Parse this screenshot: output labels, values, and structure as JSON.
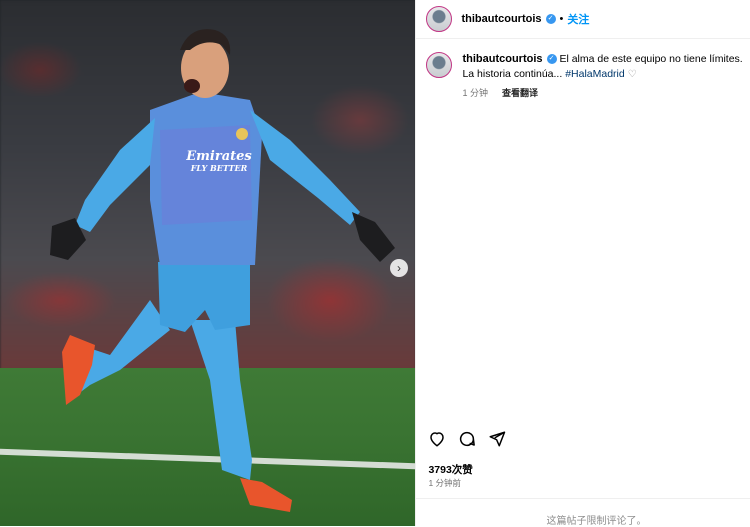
{
  "post": {
    "username": "thibautcourtois",
    "follow_label": "关注",
    "separator": "•",
    "caption_text": "El alma de este equipo no tiene límites. La historia continúa...",
    "hashtag": "#HalaMadrid",
    "caption_time": "1 分钟",
    "translate_label": "查看翻译",
    "likes": "3793次赞",
    "post_time": "1 分钟前",
    "comments_restricted": "这篇帖子限制评论了。"
  },
  "media": {
    "jersey_sponsor_line1": "Emirates",
    "jersey_sponsor_line2": "FLY BETTER",
    "carousel_dots": 4,
    "carousel_active": 1
  },
  "colors": {
    "follow_blue": "#0095f6",
    "verified_blue": "#3797f0",
    "hashtag": "#00376b",
    "kit_blue": "#4aa9e6"
  },
  "icons": {
    "next": "chevron-right-icon",
    "like": "heart-icon",
    "comment": "comment-icon",
    "share": "share-icon",
    "verified": "verified-badge-icon"
  }
}
